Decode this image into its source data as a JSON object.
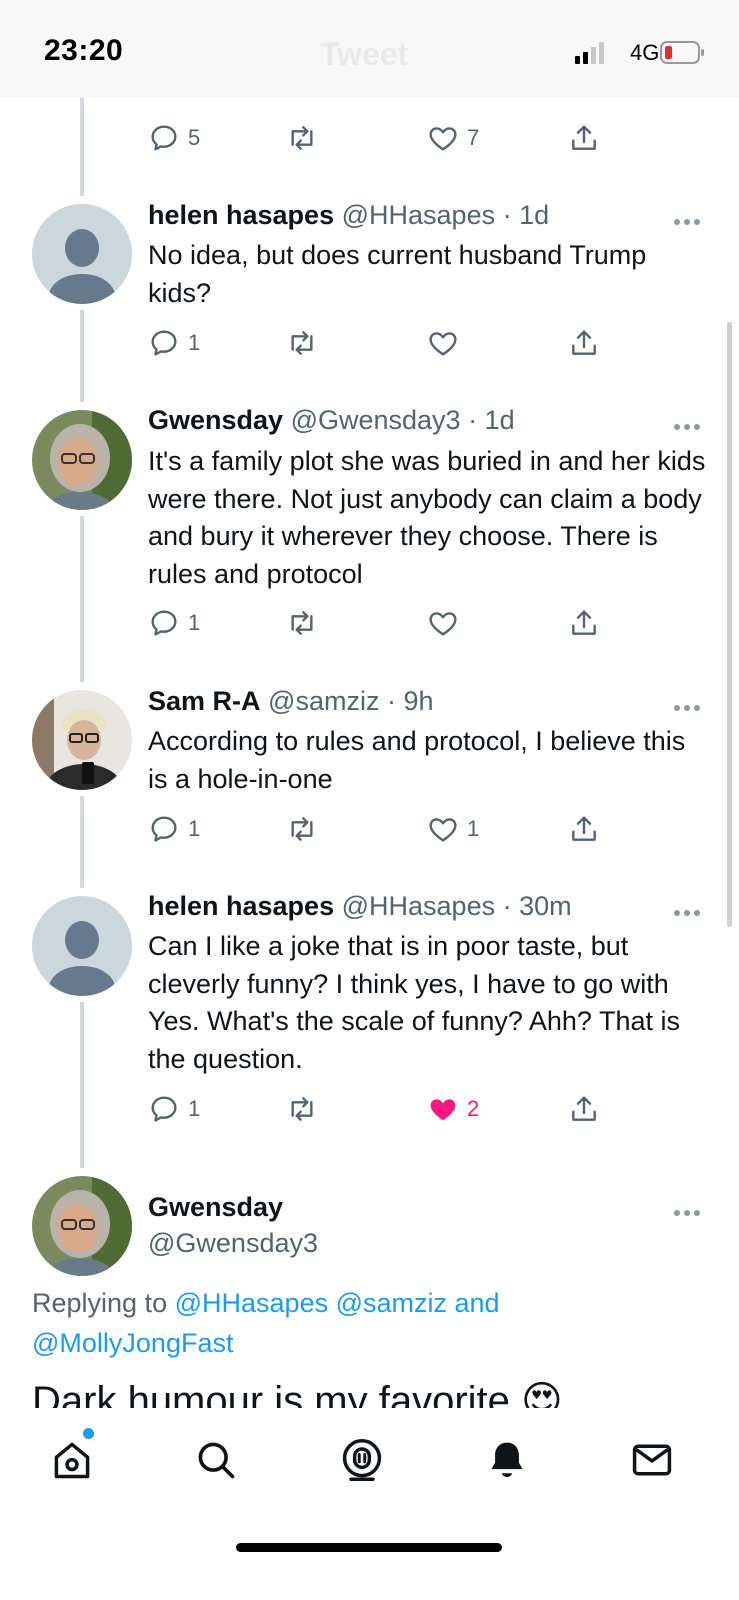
{
  "status_bar": {
    "time": "23:20",
    "network": "4G",
    "ghost_title": "Tweet"
  },
  "first_actions": {
    "replies": "5",
    "likes": "7"
  },
  "tweets": [
    {
      "name": "helen hasapes",
      "handle_time": "@HHasapes · 1d",
      "text": "No idea, but does current husband Trump kids?",
      "replies": "1",
      "likes": "",
      "liked": false,
      "avatar": "default-avatar"
    },
    {
      "name": "Gwensday",
      "handle_time": "@Gwensday3 · 1d",
      "text": "It's a family plot she was buried in and her kids were there. Not just anybody can claim a body and bury it wherever they choose. There is rules and protocol",
      "replies": "1",
      "likes": "",
      "liked": false,
      "avatar": "gwensday-photo"
    },
    {
      "name": "Sam R-A",
      "handle_time": "@samziz · 9h",
      "text": "According to rules and protocol, I believe this is a hole-in-one",
      "replies": "1",
      "likes": "1",
      "liked": false,
      "avatar": "sam-photo"
    },
    {
      "name": "helen hasapes",
      "handle_time": "@HHasapes · 30m",
      "text": "Can I like a joke that is in poor taste, but cleverly funny? I think yes, I have to go with Yes. What's the scale of funny? Ahh? That is the question.",
      "replies": "1",
      "likes": "2",
      "liked": true,
      "avatar": "default-avatar"
    }
  ],
  "main_tweet": {
    "name": "Gwensday",
    "handle": "@Gwensday3",
    "replying_prefix": "Replying to",
    "replying_line1": "@HHasapes @samziz and",
    "replying_line2": "@MollyJongFast",
    "text": "Dark humour is my favorite",
    "emoji": "😍"
  },
  "bottom_nav": [
    {
      "icon": "home-icon",
      "has_badge": true
    },
    {
      "icon": "search-icon"
    },
    {
      "icon": "spaces-icon"
    },
    {
      "icon": "notifications-bell-icon"
    },
    {
      "icon": "messages-mail-icon"
    }
  ],
  "colors": {
    "accent": "#1d9bf0",
    "like": "#f91880",
    "secondary_text": "#536471",
    "thread_line": "#cfd9de"
  }
}
